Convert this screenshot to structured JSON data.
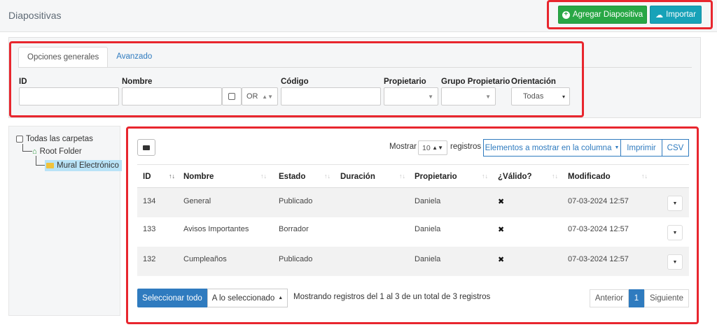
{
  "header": {
    "title": "Diapositivas",
    "add_button": "Agregar Diapositiva",
    "add_icon": "plus-circle-icon",
    "import_button": "Importar",
    "import_icon": "cloud-upload-icon"
  },
  "filters": {
    "tabs": [
      {
        "label": "Opciones generales",
        "active": true
      },
      {
        "label": "Avanzado",
        "active": false
      }
    ],
    "id_label": "ID",
    "nombre_label": "Nombre",
    "nombre_operator": "OR",
    "codigo_label": "Código",
    "propietario_label": "Propietario",
    "grupo_label": "Grupo Propietario",
    "orientacion_label": "Orientación",
    "orientacion_value": "Todas"
  },
  "tree": {
    "all_folders": "Todas las carpetas",
    "root": "Root Folder",
    "child": "Mural Electrónico"
  },
  "table": {
    "show_label": "Mostrar",
    "show_value": "10",
    "records_label": "registros",
    "columns_button": "Elementos a mostrar en la columna",
    "print_button": "Imprimir",
    "csv_button": "CSV",
    "headers": [
      "ID",
      "Nombre",
      "Estado",
      "Duración",
      "Propietario",
      "¿Válido?",
      "Modificado"
    ],
    "rows": [
      {
        "id": "134",
        "nombre": "General",
        "estado": "Publicado",
        "duracion": "",
        "propietario": "Daniela",
        "valido": "✖",
        "modificado": "07-03-2024 12:57"
      },
      {
        "id": "133",
        "nombre": "Avisos Importantes",
        "estado": "Borrador",
        "duracion": "",
        "propietario": "Daniela",
        "valido": "✖",
        "modificado": "07-03-2024 12:57"
      },
      {
        "id": "132",
        "nombre": "Cumpleaños",
        "estado": "Publicado",
        "duracion": "",
        "propietario": "Daniela",
        "valido": "✖",
        "modificado": "07-03-2024 12:57"
      }
    ],
    "select_all": "Seleccionar todo",
    "with_selected": "A lo seleccionado",
    "info": "Mostrando registros del 1 al 3 de un total de 3 registros",
    "prev": "Anterior",
    "page": "1",
    "next": "Siguiente"
  },
  "colors": {
    "highlight": "#e8262e",
    "green": "#28a745",
    "teal": "#17a2b8",
    "primary": "#2f7bbf"
  }
}
